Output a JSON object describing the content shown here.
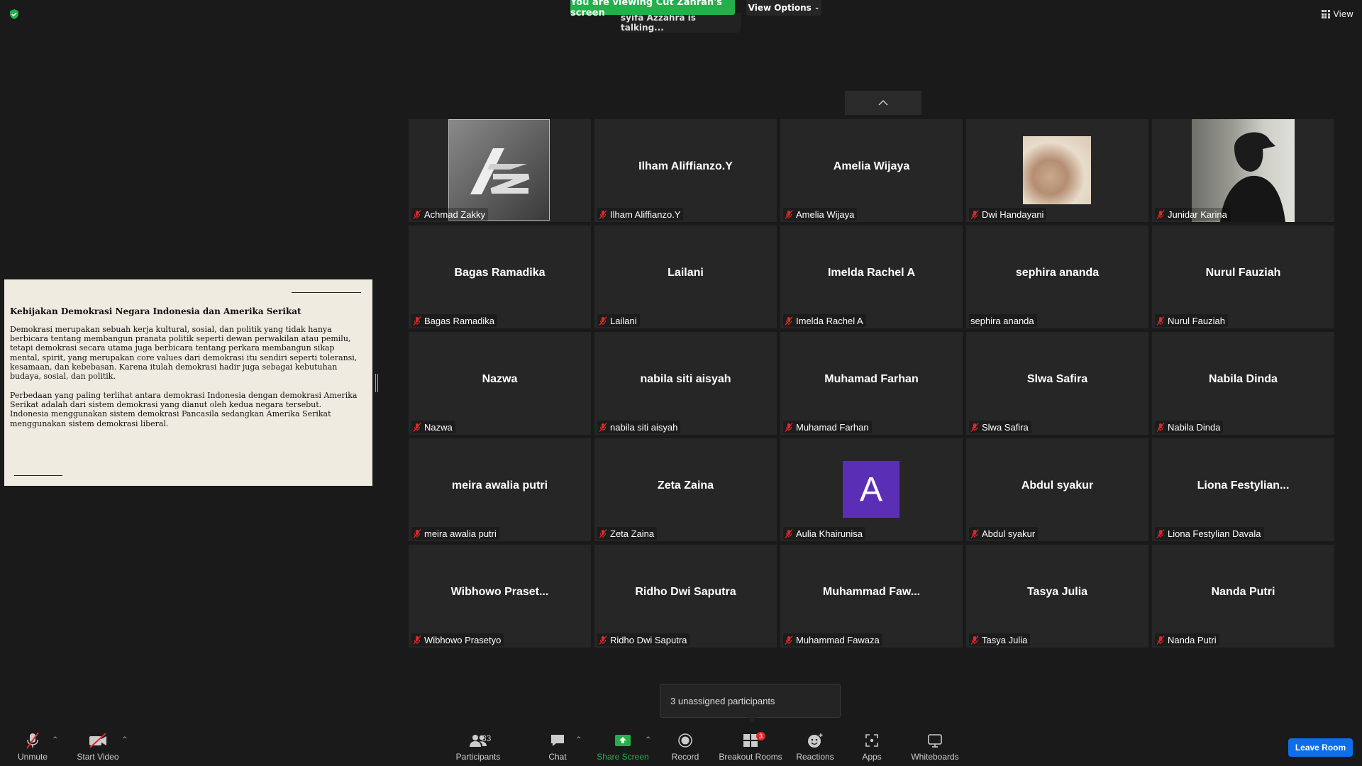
{
  "top": {
    "viewing_banner": "You are viewing Cut Zahrah's screen",
    "view_options": "View Options",
    "talking": "syifa Azzahra is talking...",
    "view_button": "View"
  },
  "shared_screen": {
    "title": "Kebijakan Demokrasi Negara Indonesia dan Amerika Serikat",
    "paragraph_1": "Demokrasi merupakan sebuah kerja kultural, sosial, dan politik yang tidak hanya berbicara tentang membangun pranata politik seperti dewan perwakilan atau pemilu, tetapi demokrasi secara utama juga berbicara tentang perkara membangun sikap mental, spirit, yang merupakan core values dari demokrasi itu sendiri seperti toleransi, kesamaan, dan kebebasan. Karena itulah demokrasi hadir juga sebagai kebutuhan budaya, sosial, dan politik.",
    "paragraph_2": "Perbedaan yang paling terlihat antara demokrasi Indonesia dengan demokrasi Amerika Serikat adalah dari sistem demokrasi yang dianut oleh kedua negara tersebut. Indonesia menggunakan sistem demokrasi Pancasila sedangkan Amerika Serikat menggunakan sistem demokrasi liberal."
  },
  "participants": [
    {
      "display": "",
      "name": "Achmad Zakky",
      "muted": true,
      "tile": "logo"
    },
    {
      "display": "Ilham Aliffianzo.Y",
      "name": "Ilham Aliffianzo.Y",
      "muted": true
    },
    {
      "display": "Amelia Wijaya",
      "name": "Amelia Wijaya",
      "muted": true
    },
    {
      "display": "",
      "name": "Dwi Handayani",
      "muted": true,
      "tile": "photo-cat"
    },
    {
      "display": "",
      "name": "Junidar Karina",
      "muted": true,
      "tile": "photo-person"
    },
    {
      "display": "Bagas Ramadika",
      "name": "Bagas Ramadika",
      "muted": true
    },
    {
      "display": "Lailani",
      "name": "Lailani",
      "muted": true
    },
    {
      "display": "Imelda Rachel A",
      "name": "Imelda Rachel A",
      "muted": true
    },
    {
      "display": "sephira ananda",
      "name": "sephira ananda",
      "muted": false
    },
    {
      "display": "Nurul Fauziah",
      "name": "Nurul Fauziah",
      "muted": true
    },
    {
      "display": "Nazwa",
      "name": "Nazwa",
      "muted": true
    },
    {
      "display": "nabila siti aisyah",
      "name": "nabila siti aisyah",
      "muted": true
    },
    {
      "display": "Muhamad Farhan",
      "name": "Muhamad Farhan",
      "muted": true
    },
    {
      "display": "Slwa Safira",
      "name": "Slwa Safira",
      "muted": true
    },
    {
      "display": "Nabila Dinda",
      "name": "Nabila Dinda",
      "muted": true
    },
    {
      "display": "meira awalia putri",
      "name": "meira awalia putri",
      "muted": true
    },
    {
      "display": "Zeta Zaina",
      "name": "Zeta Zaina",
      "muted": true
    },
    {
      "display": "",
      "name": "Aulia Khairunisa",
      "muted": true,
      "tile": "avatar",
      "avatar_letter": "A"
    },
    {
      "display": "Abdul syakur",
      "name": "Abdul syakur",
      "muted": true
    },
    {
      "display": "Liona  Festylian...",
      "name": "Liona Festylian Davala",
      "muted": true
    },
    {
      "display": "Wibhowo  Praset...",
      "name": "Wibhowo Prasetyo",
      "muted": true
    },
    {
      "display": "Ridho Dwi Saputra",
      "name": "Ridho Dwi Saputra",
      "muted": true
    },
    {
      "display": "Muhammad  Faw...",
      "name": "Muhammad Fawaza",
      "muted": true
    },
    {
      "display": "Tasya Julia",
      "name": "Tasya Julia",
      "muted": true
    },
    {
      "display": "Nanda Putri",
      "name": "Nanda Putri",
      "muted": true
    }
  ],
  "unassigned": "3 unassigned participants",
  "toolbar": {
    "unmute": "Unmute",
    "start_video": "Start Video",
    "participants": "Participants",
    "participants_count": "33",
    "chat": "Chat",
    "share_screen": "Share Screen",
    "record": "Record",
    "breakout_rooms": "Breakout Rooms",
    "breakout_badge": "3",
    "reactions": "Reactions",
    "apps": "Apps",
    "whiteboards": "Whiteboards",
    "leave_room": "Leave Room"
  },
  "colors": {
    "accent_green": "#23b04a",
    "leave_blue": "#0e6ee6",
    "avatar_purple": "#5b2fb5",
    "mic_red": "#e02828"
  }
}
